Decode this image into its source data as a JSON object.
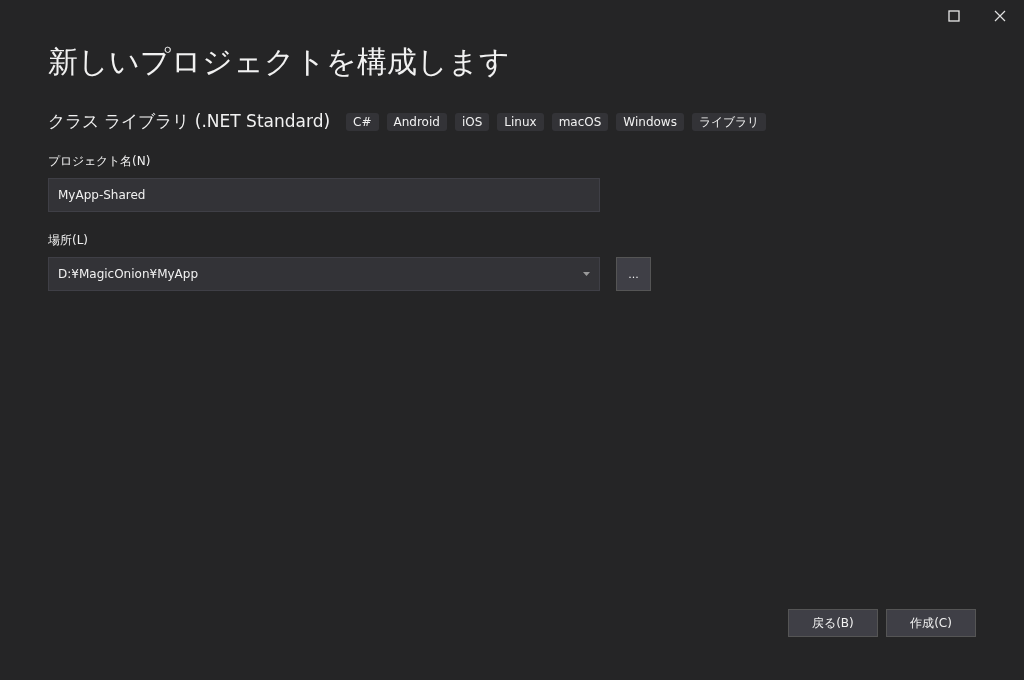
{
  "window": {
    "title": "新しいプロジェクトを構成します"
  },
  "template": {
    "name": "クラス ライブラリ (.NET Standard)",
    "tags": [
      "C#",
      "Android",
      "iOS",
      "Linux",
      "macOS",
      "Windows",
      "ライブラリ"
    ]
  },
  "fields": [
    {
      "kind": "text",
      "label": "プロジェクト名(N)",
      "value": "MyApp-Shared"
    },
    {
      "kind": "dropdown",
      "label": "場所(L)",
      "value": "D:¥MagicOnion¥MyApp",
      "browse_label": "..."
    }
  ],
  "buttons": [
    {
      "label": "戻る(B)"
    },
    {
      "label": "作成(C)"
    }
  ]
}
